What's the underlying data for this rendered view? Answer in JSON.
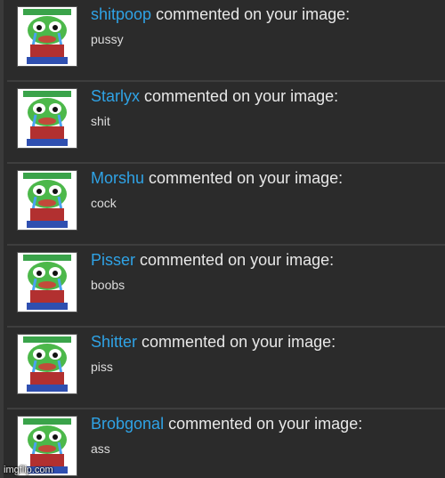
{
  "notifications": [
    {
      "username": "shitpoop",
      "action": "commented on your image:",
      "comment": "pussy",
      "thumb_icon": "crying-frog-avatar-icon"
    },
    {
      "username": "Starlyx",
      "action": "commented on your image:",
      "comment": "shit",
      "thumb_icon": "crying-frog-avatar-icon"
    },
    {
      "username": "Morshu",
      "action": "commented on your image:",
      "comment": "cock",
      "thumb_icon": "crying-frog-avatar-icon"
    },
    {
      "username": "Pisser",
      "action": "commented on your image:",
      "comment": "boobs",
      "thumb_icon": "crying-frog-avatar-icon"
    },
    {
      "username": "Shitter",
      "action": "commented on your image:",
      "comment": "piss",
      "thumb_icon": "crying-frog-avatar-icon"
    },
    {
      "username": "Brobgonal",
      "action": "commented on your image:",
      "comment": "ass",
      "thumb_icon": "crying-frog-avatar-icon"
    }
  ],
  "watermark": "imgflip.com",
  "colors": {
    "background": "#2b2b2b",
    "username": "#2fa3e6",
    "text": "#e8e8e8",
    "divider": "#3e3e3e"
  }
}
